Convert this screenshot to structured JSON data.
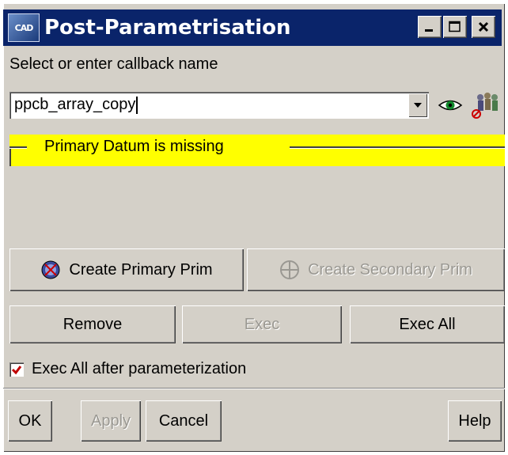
{
  "window": {
    "title": "Post-Parametrisation",
    "app_icon_text": "CAD",
    "minimize_label": "_",
    "maximize_label": "□",
    "close_label": "✕"
  },
  "callback": {
    "label": "Select or enter callback name",
    "value": "ppcb_array_copy",
    "dropdown_icon": "chevron-down-icon",
    "view_icon": "eye-icon",
    "people_icon": "users-icon"
  },
  "status": {
    "message": "Primary Datum  is missing",
    "color": "#ffff00"
  },
  "buttons": {
    "create_primary": "Create Primary Prim",
    "create_secondary": "Create Secondary Prim",
    "remove": "Remove",
    "exec": "Exec",
    "exec_all": "Exec All"
  },
  "option": {
    "label": "Exec All after parameterization",
    "checked": true
  },
  "footer": {
    "ok": "OK",
    "apply": "Apply",
    "cancel": "Cancel",
    "help": "Help"
  },
  "colors": {
    "titlebar": "#0a246a",
    "dialog": "#d4d0c8",
    "check": "#c00000"
  }
}
